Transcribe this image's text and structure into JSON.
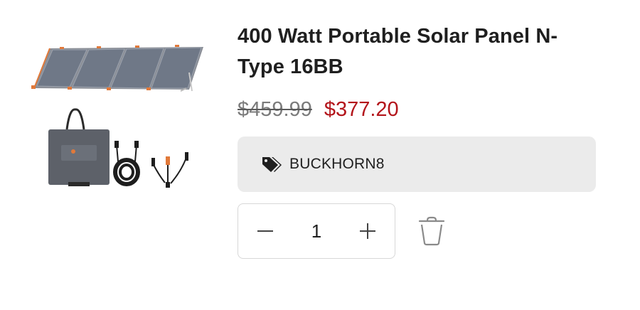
{
  "product": {
    "title": "400 Watt Portable Solar Panel N-Type 16BB",
    "compare_price": "$459.99",
    "sale_price": "$377.20",
    "image_icon": "product-thumbnail"
  },
  "discount": {
    "icon": "tag-icon",
    "code": "BUCKHORN8",
    "background": "#ebebeb"
  },
  "quantity": {
    "value": "1",
    "decrease_icon": "minus-icon",
    "increase_icon": "plus-icon"
  },
  "actions": {
    "remove_icon": "trash-icon"
  },
  "colors": {
    "sale_price": "#b3151b",
    "compare_price": "#7b7b7b",
    "panel_cells": "#6f7887",
    "panel_frame": "#e1793a"
  }
}
